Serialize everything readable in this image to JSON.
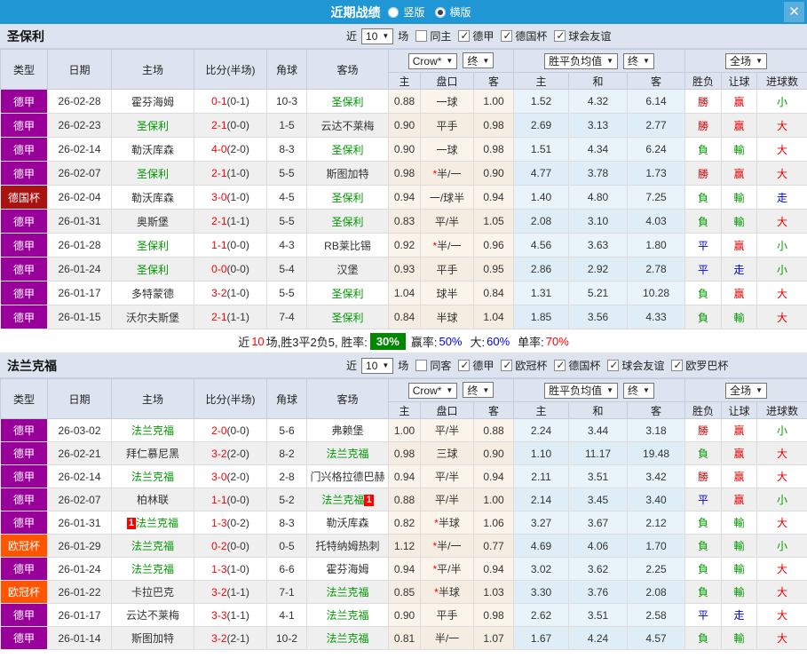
{
  "titlebar": {
    "title": "近期战绩",
    "radio_vertical": "竖版",
    "radio_horizontal": "横版",
    "selected_mode": "横版",
    "close": "✕"
  },
  "colors": {
    "titlebar_blue": "#1f97d4",
    "bundesliga_purple": "#990099",
    "dfb_pokal_red": "#aa1111",
    "champions_league_orange": "#ff5500",
    "team_green": "#009900",
    "win_red": "#e60000",
    "lose_green": "#009900",
    "draw_blue": "#0000dd",
    "rate_badge_green": "#008800"
  },
  "table_header": {
    "cols": [
      "类型",
      "日期",
      "主场",
      "比分(半场)",
      "角球",
      "客场"
    ],
    "handicap_source_dropdown": "Crow*",
    "handicap_final_dropdown": "终",
    "europe_source_dropdown": "胜平负均值",
    "europe_final_dropdown": "终",
    "scope_dropdown": "全场",
    "sub": [
      "主",
      "盘口",
      "客",
      "主",
      "和",
      "客",
      "胜负",
      "让球",
      "进球数"
    ]
  },
  "sections": [
    {
      "team": "圣保利",
      "filters": {
        "near_label": "近",
        "count": "10",
        "games_label": "场",
        "venue": {
          "label": "同主",
          "checked": false
        },
        "leagues": [
          {
            "label": "德甲",
            "checked": true
          },
          {
            "label": "德国杯",
            "checked": true
          },
          {
            "label": "球会友谊",
            "checked": true
          }
        ]
      },
      "rows": [
        {
          "league": "德甲",
          "lc": "#990099",
          "date": "26-02-28",
          "home": "霍芬海姆",
          "ht": false,
          "score": "0-1",
          "half": "(0-1)",
          "corner": "10-3",
          "away": "圣保利",
          "at": true,
          "hh": "0.88",
          "line": "一球",
          "star": false,
          "ha": "1.00",
          "eh": "1.52",
          "ed": "4.32",
          "ea": "6.14",
          "r1": "勝",
          "c1": "red",
          "r2": "赢",
          "c2": "red",
          "r3": "小",
          "c3": "green"
        },
        {
          "league": "德甲",
          "lc": "#990099",
          "date": "26-02-23",
          "home": "圣保利",
          "ht": true,
          "score": "2-1",
          "half": "(0-0)",
          "corner": "1-5",
          "away": "云达不莱梅",
          "at": false,
          "hh": "0.90",
          "line": "平手",
          "star": false,
          "ha": "0.98",
          "eh": "2.69",
          "ed": "3.13",
          "ea": "2.77",
          "r1": "勝",
          "c1": "red",
          "r2": "赢",
          "c2": "red",
          "r3": "大",
          "c3": "red"
        },
        {
          "league": "德甲",
          "lc": "#990099",
          "date": "26-02-14",
          "home": "勒沃库森",
          "ht": false,
          "score": "4-0",
          "half": "(2-0)",
          "corner": "8-3",
          "away": "圣保利",
          "at": true,
          "hh": "0.90",
          "line": "一球",
          "star": false,
          "ha": "0.98",
          "eh": "1.51",
          "ed": "4.34",
          "ea": "6.24",
          "r1": "負",
          "c1": "green",
          "r2": "輸",
          "c2": "green",
          "r3": "大",
          "c3": "red"
        },
        {
          "league": "德甲",
          "lc": "#990099",
          "date": "26-02-07",
          "home": "圣保利",
          "ht": true,
          "score": "2-1",
          "half": "(1-0)",
          "corner": "5-5",
          "away": "斯图加特",
          "at": false,
          "hh": "0.98",
          "line": "半/一",
          "star": true,
          "ha": "0.90",
          "eh": "4.77",
          "ed": "3.78",
          "ea": "1.73",
          "r1": "勝",
          "c1": "red",
          "r2": "赢",
          "c2": "red",
          "r3": "大",
          "c3": "red"
        },
        {
          "league": "德国杯",
          "lc": "#aa1111",
          "date": "26-02-04",
          "home": "勒沃库森",
          "ht": false,
          "score": "3-0",
          "half": "(1-0)",
          "corner": "4-5",
          "away": "圣保利",
          "at": true,
          "hh": "0.94",
          "line": "一/球半",
          "star": false,
          "ha": "0.94",
          "eh": "1.40",
          "ed": "4.80",
          "ea": "7.25",
          "r1": "負",
          "c1": "green",
          "r2": "輸",
          "c2": "green",
          "r3": "走",
          "c3": "blue"
        },
        {
          "league": "德甲",
          "lc": "#990099",
          "date": "26-01-31",
          "home": "奥斯堡",
          "ht": false,
          "score": "2-1",
          "half": "(1-1)",
          "corner": "5-5",
          "away": "圣保利",
          "at": true,
          "hh": "0.83",
          "line": "平/半",
          "star": false,
          "ha": "1.05",
          "eh": "2.08",
          "ed": "3.10",
          "ea": "4.03",
          "r1": "負",
          "c1": "green",
          "r2": "輸",
          "c2": "green",
          "r3": "大",
          "c3": "red"
        },
        {
          "league": "德甲",
          "lc": "#990099",
          "date": "26-01-28",
          "home": "圣保利",
          "ht": true,
          "score": "1-1",
          "half": "(0-0)",
          "corner": "4-3",
          "away": "RB莱比锡",
          "at": false,
          "hh": "0.92",
          "line": "半/一",
          "star": true,
          "ha": "0.96",
          "eh": "4.56",
          "ed": "3.63",
          "ea": "1.80",
          "r1": "平",
          "c1": "blue",
          "r2": "赢",
          "c2": "red",
          "r3": "小",
          "c3": "green"
        },
        {
          "league": "德甲",
          "lc": "#990099",
          "date": "26-01-24",
          "home": "圣保利",
          "ht": true,
          "score": "0-0",
          "half": "(0-0)",
          "corner": "5-4",
          "away": "汉堡",
          "at": false,
          "hh": "0.93",
          "line": "平手",
          "star": false,
          "ha": "0.95",
          "eh": "2.86",
          "ed": "2.92",
          "ea": "2.78",
          "r1": "平",
          "c1": "blue",
          "r2": "走",
          "c2": "blue",
          "r3": "小",
          "c3": "green"
        },
        {
          "league": "德甲",
          "lc": "#990099",
          "date": "26-01-17",
          "home": "多特蒙德",
          "ht": false,
          "score": "3-2",
          "half": "(1-0)",
          "corner": "5-5",
          "away": "圣保利",
          "at": true,
          "hh": "1.04",
          "line": "球半",
          "star": false,
          "ha": "0.84",
          "eh": "1.31",
          "ed": "5.21",
          "ea": "10.28",
          "r1": "負",
          "c1": "green",
          "r2": "赢",
          "c2": "red",
          "r3": "大",
          "c3": "red"
        },
        {
          "league": "德甲",
          "lc": "#990099",
          "date": "26-01-15",
          "home": "沃尔夫斯堡",
          "ht": false,
          "score": "2-1",
          "half": "(1-1)",
          "corner": "7-4",
          "away": "圣保利",
          "at": true,
          "hh": "0.84",
          "line": "半球",
          "star": false,
          "ha": "1.04",
          "eh": "1.85",
          "ed": "3.56",
          "ea": "4.33",
          "r1": "負",
          "c1": "green",
          "r2": "輸",
          "c2": "green",
          "r3": "大",
          "c3": "red"
        }
      ],
      "summary": {
        "near": "近",
        "count": "10",
        "text": "场,胜3平2负5, 胜率:",
        "win_rate": "30%",
        "handicap_label": "赢率:",
        "handicap_rate": "50%",
        "big_label": "大:",
        "big_rate": "60%",
        "single_label": "单率:",
        "single_rate": "70%"
      }
    },
    {
      "team": "法兰克福",
      "filters": {
        "near_label": "近",
        "count": "10",
        "games_label": "场",
        "venue": {
          "label": "同客",
          "checked": false
        },
        "leagues": [
          {
            "label": "德甲",
            "checked": true
          },
          {
            "label": "欧冠杯",
            "checked": true
          },
          {
            "label": "德国杯",
            "checked": true
          },
          {
            "label": "球会友谊",
            "checked": true
          },
          {
            "label": "欧罗巴杯",
            "checked": true
          }
        ]
      },
      "rows": [
        {
          "league": "德甲",
          "lc": "#990099",
          "date": "26-03-02",
          "home": "法兰克福",
          "ht": true,
          "score": "2-0",
          "half": "(0-0)",
          "corner": "5-6",
          "away": "弗赖堡",
          "at": false,
          "hh": "1.00",
          "line": "平/半",
          "star": false,
          "ha": "0.88",
          "eh": "2.24",
          "ed": "3.44",
          "ea": "3.18",
          "r1": "勝",
          "c1": "red",
          "r2": "赢",
          "c2": "red",
          "r3": "小",
          "c3": "green"
        },
        {
          "league": "德甲",
          "lc": "#990099",
          "date": "26-02-21",
          "home": "拜仁慕尼黑",
          "ht": false,
          "score": "3-2",
          "half": "(2-0)",
          "corner": "8-2",
          "away": "法兰克福",
          "at": true,
          "hh": "0.98",
          "line": "三球",
          "star": false,
          "ha": "0.90",
          "eh": "1.10",
          "ed": "11.17",
          "ea": "19.48",
          "r1": "負",
          "c1": "green",
          "r2": "赢",
          "c2": "red",
          "r3": "大",
          "c3": "red"
        },
        {
          "league": "德甲",
          "lc": "#990099",
          "date": "26-02-14",
          "home": "法兰克福",
          "ht": true,
          "score": "3-0",
          "half": "(2-0)",
          "corner": "2-8",
          "away": "门兴格拉德巴赫",
          "at": false,
          "hh": "0.94",
          "line": "平/半",
          "star": false,
          "ha": "0.94",
          "eh": "2.11",
          "ed": "3.51",
          "ea": "3.42",
          "r1": "勝",
          "c1": "red",
          "r2": "赢",
          "c2": "red",
          "r3": "大",
          "c3": "red"
        },
        {
          "league": "德甲",
          "lc": "#990099",
          "date": "26-02-07",
          "home": "柏林联",
          "ht": false,
          "score": "1-1",
          "half": "(0-0)",
          "corner": "5-2",
          "away": "法兰克福",
          "at": true,
          "away_badge": "1",
          "away_badge_pos": "after",
          "hh": "0.88",
          "line": "平/半",
          "star": false,
          "ha": "1.00",
          "eh": "2.14",
          "ed": "3.45",
          "ea": "3.40",
          "r1": "平",
          "c1": "blue",
          "r2": "赢",
          "c2": "red",
          "r3": "小",
          "c3": "green"
        },
        {
          "league": "德甲",
          "lc": "#990099",
          "date": "26-01-31",
          "home": "法兰克福",
          "ht": true,
          "home_badge": "1",
          "home_badge_pos": "before",
          "score": "1-3",
          "half": "(0-2)",
          "corner": "8-3",
          "away": "勒沃库森",
          "at": false,
          "hh": "0.82",
          "line": "半球",
          "star": true,
          "ha": "1.06",
          "eh": "3.27",
          "ed": "3.67",
          "ea": "2.12",
          "r1": "負",
          "c1": "green",
          "r2": "輸",
          "c2": "green",
          "r3": "大",
          "c3": "red"
        },
        {
          "league": "欧冠杯",
          "lc": "#ff5500",
          "date": "26-01-29",
          "home": "法兰克福",
          "ht": true,
          "score": "0-2",
          "half": "(0-0)",
          "corner": "0-5",
          "away": "托特纳姆热刺",
          "at": false,
          "hh": "1.12",
          "line": "半/一",
          "star": true,
          "ha": "0.77",
          "eh": "4.69",
          "ed": "4.06",
          "ea": "1.70",
          "r1": "負",
          "c1": "green",
          "r2": "輸",
          "c2": "green",
          "r3": "小",
          "c3": "green"
        },
        {
          "league": "德甲",
          "lc": "#990099",
          "date": "26-01-24",
          "home": "法兰克福",
          "ht": true,
          "score": "1-3",
          "half": "(1-0)",
          "corner": "6-6",
          "away": "霍芬海姆",
          "at": false,
          "hh": "0.94",
          "line": "平/半",
          "star": true,
          "ha": "0.94",
          "eh": "3.02",
          "ed": "3.62",
          "ea": "2.25",
          "r1": "負",
          "c1": "green",
          "r2": "輸",
          "c2": "green",
          "r3": "大",
          "c3": "red"
        },
        {
          "league": "欧冠杯",
          "lc": "#ff5500",
          "date": "26-01-22",
          "home": "卡拉巴克",
          "ht": false,
          "score": "3-2",
          "half": "(1-1)",
          "corner": "7-1",
          "away": "法兰克福",
          "at": true,
          "hh": "0.85",
          "line": "半球",
          "star": true,
          "ha": "1.03",
          "eh": "3.30",
          "ed": "3.76",
          "ea": "2.08",
          "r1": "負",
          "c1": "green",
          "r2": "輸",
          "c2": "green",
          "r3": "大",
          "c3": "red"
        },
        {
          "league": "德甲",
          "lc": "#990099",
          "date": "26-01-17",
          "home": "云达不莱梅",
          "ht": false,
          "score": "3-3",
          "half": "(1-1)",
          "corner": "4-1",
          "away": "法兰克福",
          "at": true,
          "hh": "0.90",
          "line": "平手",
          "star": false,
          "ha": "0.98",
          "eh": "2.62",
          "ed": "3.51",
          "ea": "2.58",
          "r1": "平",
          "c1": "blue",
          "r2": "走",
          "c2": "blue",
          "r3": "大",
          "c3": "red"
        },
        {
          "league": "德甲",
          "lc": "#990099",
          "date": "26-01-14",
          "home": "斯图加特",
          "ht": false,
          "score": "3-2",
          "half": "(2-1)",
          "corner": "10-2",
          "away": "法兰克福",
          "at": true,
          "hh": "0.81",
          "line": "半/一",
          "star": false,
          "ha": "1.07",
          "eh": "1.67",
          "ed": "4.24",
          "ea": "4.57",
          "r1": "負",
          "c1": "green",
          "r2": "輸",
          "c2": "green",
          "r3": "大",
          "c3": "red"
        }
      ]
    }
  ]
}
